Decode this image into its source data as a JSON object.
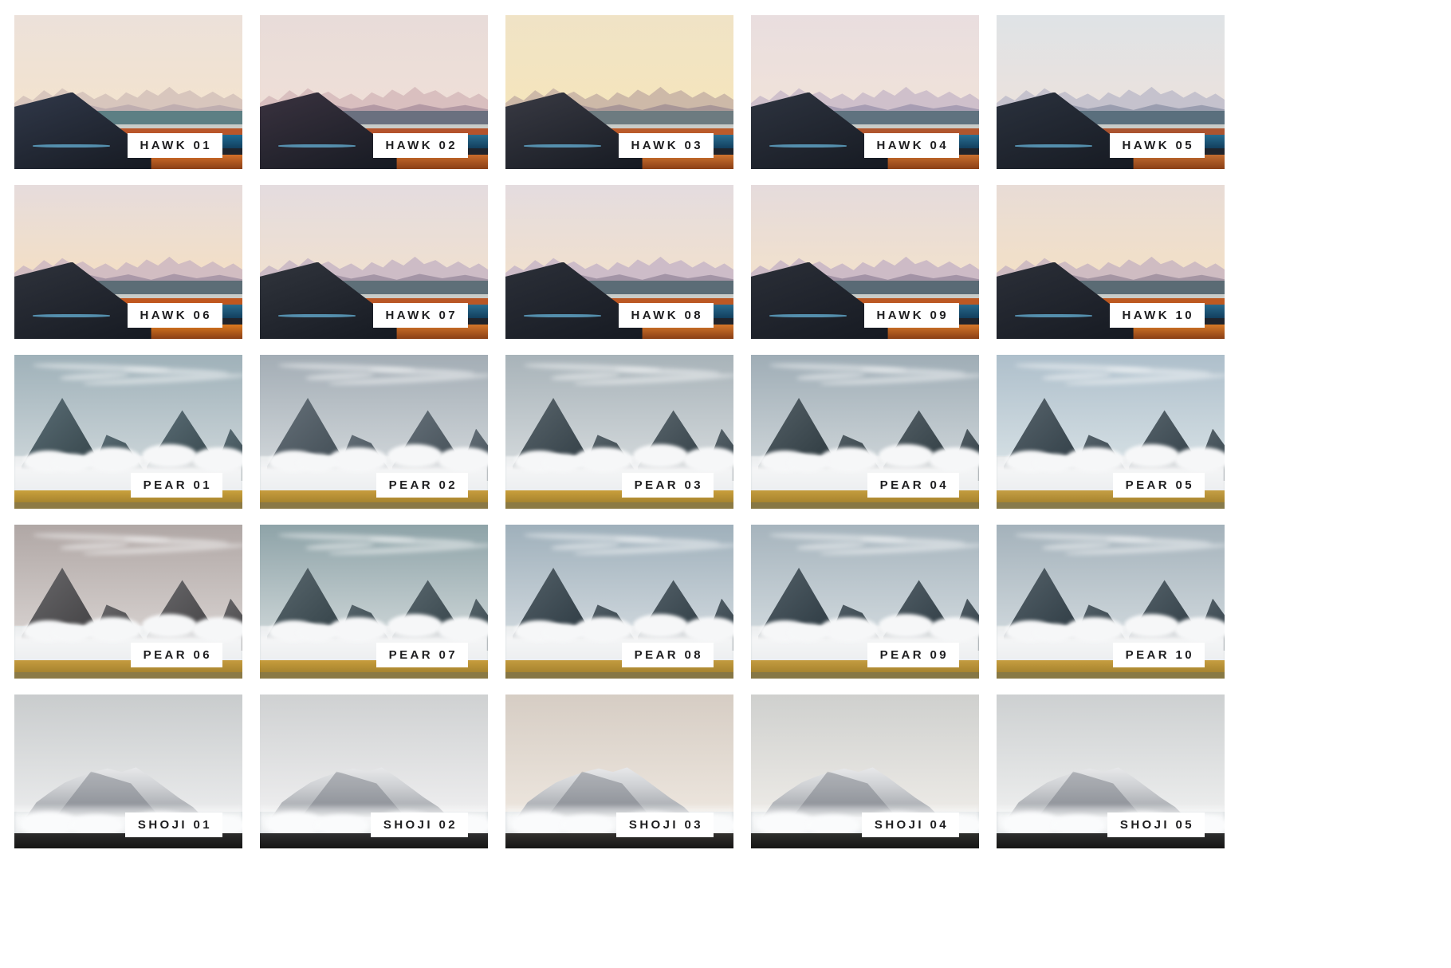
{
  "page": {
    "title": "Photo Preset Preview Grid",
    "background": "#ffffff",
    "columns": 5,
    "rows": 5,
    "tile_count": 25,
    "label_background": "#ffffff",
    "label_text_color": "#1d1d1f"
  },
  "tiles": [
    {
      "label": "HAWK 01",
      "scene": "hawk",
      "colors": {
        "sky_top": "#ece1da",
        "sky_bottom": "#f3e3ce",
        "ridge_far": "#d8c6bd",
        "ridge_mid": "#b9a8ad",
        "hill": "#31394a",
        "teal": "#5d7f84",
        "rust": "#b9562a",
        "water": "#1f6b94",
        "field": "#d4702a"
      }
    },
    {
      "label": "HAWK 02",
      "scene": "hawk",
      "colors": {
        "sky_top": "#e8dcd9",
        "sky_bottom": "#efdfd7",
        "ridge_far": "#d9bfbf",
        "ridge_mid": "#a9909e",
        "hill": "#3b3340",
        "teal": "#6a707f",
        "rust": "#b4532c",
        "water": "#2a6d8f",
        "field": "#c96c2c"
      }
    },
    {
      "label": "HAWK 03",
      "scene": "hawk",
      "colors": {
        "sky_top": "#f0e3c6",
        "sky_bottom": "#f5e5bc",
        "ridge_far": "#cdb9a8",
        "ridge_mid": "#9f8d92",
        "hill": "#3a3b44",
        "teal": "#6d7b80",
        "rust": "#ba5b2b",
        "water": "#2b6f91",
        "field": "#cf7430"
      }
    },
    {
      "label": "HAWK 04",
      "scene": "hawk",
      "colors": {
        "sky_top": "#e9dedf",
        "sky_bottom": "#f0e2d9",
        "ridge_far": "#cfc0cb",
        "ridge_mid": "#9c93ac",
        "hill": "#2e3440",
        "teal": "#5f727f",
        "rust": "#b0562e",
        "water": "#2a6f93",
        "field": "#c96f2e"
      }
    },
    {
      "label": "HAWK 05",
      "scene": "hawk",
      "colors": {
        "sky_top": "#dfe3e6",
        "sky_bottom": "#ebe2dd",
        "ridge_far": "#c5c2cd",
        "ridge_mid": "#8f93a8",
        "hill": "#2b323e",
        "teal": "#5a6f7d",
        "rust": "#ab5430",
        "water": "#276c90",
        "field": "#c36d31"
      }
    },
    {
      "label": "HAWK 06",
      "scene": "hawk",
      "colors": {
        "sky_top": "#e6dcdc",
        "sky_bottom": "#f4dfc4",
        "ridge_far": "#d2bdc2",
        "ridge_mid": "#a08ea1",
        "hill": "#2f333c",
        "teal": "#5c6d76",
        "rust": "#c0571f",
        "water": "#2a6c8e",
        "field": "#dd7a1f"
      }
    },
    {
      "label": "HAWK 07",
      "scene": "hawk",
      "colors": {
        "sky_top": "#e4dcdf",
        "sky_bottom": "#f0e0cf",
        "ridge_far": "#cdbcc6",
        "ridge_mid": "#9a8b9e",
        "hill": "#31353d",
        "teal": "#5e6f78",
        "rust": "#b95726",
        "water": "#2a6d90",
        "field": "#d4762a"
      }
    },
    {
      "label": "HAWK 08",
      "scene": "hawk",
      "colors": {
        "sky_top": "#e4dcdf",
        "sky_bottom": "#f1e0cd",
        "ridge_far": "#cdbcc8",
        "ridge_mid": "#99899d",
        "hill": "#2c3039",
        "teal": "#5b6c76",
        "rust": "#bb5824",
        "water": "#296b8e",
        "field": "#d5772a"
      }
    },
    {
      "label": "HAWK 09",
      "scene": "hawk",
      "colors": {
        "sky_top": "#e5dbdc",
        "sky_bottom": "#f2e1cc",
        "ridge_far": "#cdbbc6",
        "ridge_mid": "#988a9d",
        "hill": "#2b2f38",
        "teal": "#596a75",
        "rust": "#bb5823",
        "water": "#28698c",
        "field": "#d6782a"
      }
    },
    {
      "label": "HAWK 10",
      "scene": "hawk",
      "colors": {
        "sky_top": "#e8dcd6",
        "sky_bottom": "#f3e0c6",
        "ridge_far": "#cfbcc2",
        "ridge_mid": "#9a8b9b",
        "hill": "#2c3039",
        "teal": "#5a6b74",
        "rust": "#bd5921",
        "water": "#28698c",
        "field": "#d87a27"
      }
    },
    {
      "label": "PEAR 01",
      "scene": "pear",
      "colors": {
        "sky_top": "#9fb1b9",
        "sky_bottom": "#c8d2d6",
        "peak": "#3e4e54",
        "peak_light": "#5d7079",
        "field": "#c9a13c",
        "base": "#8d7a44"
      }
    },
    {
      "label": "PEAR 02",
      "scene": "pear",
      "colors": {
        "sky_top": "#a3adb5",
        "sky_bottom": "#ccd2d6",
        "peak": "#4a555d",
        "peak_light": "#68737c",
        "field": "#c79c3e",
        "base": "#8a7846"
      }
    },
    {
      "label": "PEAR 03",
      "scene": "pear",
      "colors": {
        "sky_top": "#a8b3b9",
        "sky_bottom": "#cfd5d8",
        "peak": "#3b474e",
        "peak_light": "#5c686f",
        "field": "#c99f3b",
        "base": "#8c7a43"
      }
    },
    {
      "label": "PEAR 04",
      "scene": "pear",
      "colors": {
        "sky_top": "#9fadb6",
        "sky_bottom": "#c9d1d5",
        "peak": "#364248",
        "peak_light": "#57636a",
        "field": "#c49c3e",
        "base": "#877744"
      }
    },
    {
      "label": "PEAR 05",
      "scene": "pear",
      "colors": {
        "sky_top": "#aebfcb",
        "sky_bottom": "#d2dde2",
        "peak": "#3a474f",
        "peak_light": "#5a676f",
        "field": "#c59f44",
        "base": "#877a4b"
      }
    },
    {
      "label": "PEAR 06",
      "scene": "pear",
      "colors": {
        "sky_top": "#b0a7a5",
        "sky_bottom": "#d3cdcb",
        "peak": "#4b4a4c",
        "peak_light": "#6b6a6d",
        "field": "#c59b3f",
        "base": "#8b7a46"
      }
    },
    {
      "label": "PEAR 07",
      "scene": "pear",
      "colors": {
        "sky_top": "#8ea3a8",
        "sky_bottom": "#c6d0d2",
        "peak": "#3c4a50",
        "peak_light": "#5c6a71",
        "field": "#c79d3c",
        "base": "#8a7944"
      }
    },
    {
      "label": "PEAR 08",
      "scene": "pear",
      "colors": {
        "sky_top": "#9fb0bb",
        "sky_bottom": "#cbd4da",
        "peak": "#36434b",
        "peak_light": "#56636b",
        "field": "#c39b3f",
        "base": "#867644"
      }
    },
    {
      "label": "PEAR 09",
      "scene": "pear",
      "colors": {
        "sky_top": "#a6b4bd",
        "sky_bottom": "#ccd5da",
        "peak": "#35424a",
        "peak_light": "#55626a",
        "field": "#c49c40",
        "base": "#867745"
      }
    },
    {
      "label": "PEAR 10",
      "scene": "pear",
      "colors": {
        "sky_top": "#a4b2bb",
        "sky_bottom": "#cbd4d9",
        "peak": "#37444c",
        "peak_light": "#57646c",
        "field": "#c69e40",
        "base": "#887944"
      }
    },
    {
      "label": "SHOJI 01",
      "scene": "shoji",
      "colors": {
        "sky_top": "#c9cccd",
        "sky_bottom": "#e9eaeb",
        "ridge": "#d6d8da",
        "fog": "#f4f5f6",
        "base": "#2b2b2b"
      }
    },
    {
      "label": "SHOJI 02",
      "scene": "shoji",
      "colors": {
        "sky_top": "#cfd1d2",
        "sky_bottom": "#ededee",
        "ridge": "#d9dbdd",
        "fog": "#f6f6f7",
        "base": "#2f2f30"
      }
    },
    {
      "label": "SHOJI 03",
      "scene": "shoji",
      "colors": {
        "sky_top": "#d6cdc4",
        "sky_bottom": "#ece5dd",
        "ridge": "#d7d6d5",
        "fog": "#f5f3f1",
        "base": "#33312e"
      }
    },
    {
      "label": "SHOJI 04",
      "scene": "shoji",
      "colors": {
        "sky_top": "#cfd0ce",
        "sky_bottom": "#eceae6",
        "ridge": "#d8d8d7",
        "fog": "#f5f5f4",
        "base": "#2e2f2c"
      }
    },
    {
      "label": "SHOJI 05",
      "scene": "shoji",
      "colors": {
        "sky_top": "#cdd0d1",
        "sky_bottom": "#eceded",
        "ridge": "#d7d9da",
        "fog": "#f5f6f6",
        "base": "#2d2e2e"
      }
    }
  ]
}
